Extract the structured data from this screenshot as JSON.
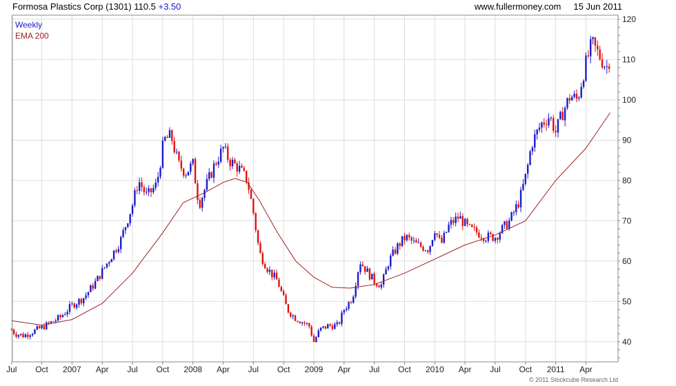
{
  "header": {
    "title": "Formosa Plastics Corp (1301)",
    "last": "110.5",
    "change": "+3.50",
    "site": "www.fullermoney.com",
    "date": "15 Jun 2011"
  },
  "footer": {
    "copyright": "© 2011 Stockcube Research Ltd"
  },
  "colors": {
    "up": "#1a1acc",
    "down": "#e01010",
    "ema": "#a02020",
    "grid": "#dddddd",
    "frame": "#888888"
  },
  "chart_data": {
    "type": "candlestick",
    "interval": "Weekly",
    "ylim": [
      35,
      121
    ],
    "yticks": [
      40,
      50,
      60,
      70,
      80,
      90,
      100,
      110,
      120
    ],
    "xlim": [
      2006.5,
      2011.5
    ],
    "xticks": [
      {
        "label": "Jul",
        "t": 2006.5
      },
      {
        "label": "Oct",
        "t": 2006.75
      },
      {
        "label": "2007",
        "t": 2007.0
      },
      {
        "label": "Apr",
        "t": 2007.25
      },
      {
        "label": "Jul",
        "t": 2007.5
      },
      {
        "label": "Oct",
        "t": 2007.75
      },
      {
        "label": "2008",
        "t": 2008.0
      },
      {
        "label": "Apr",
        "t": 2008.25
      },
      {
        "label": "Jul",
        "t": 2008.5
      },
      {
        "label": "Oct",
        "t": 2008.75
      },
      {
        "label": "2009",
        "t": 2009.0
      },
      {
        "label": "Apr",
        "t": 2009.25
      },
      {
        "label": "Jul",
        "t": 2009.5
      },
      {
        "label": "Oct",
        "t": 2009.75
      },
      {
        "label": "2010",
        "t": 2010.0
      },
      {
        "label": "Apr",
        "t": 2010.25
      },
      {
        "label": "Jul",
        "t": 2010.5
      },
      {
        "label": "Oct",
        "t": 2010.75
      },
      {
        "label": "2011",
        "t": 2011.0
      },
      {
        "label": "Apr",
        "t": 2011.25
      }
    ],
    "price_path": [
      [
        2006.5,
        43
      ],
      [
        2006.53,
        42
      ],
      [
        2006.6,
        41.5
      ],
      [
        2006.75,
        43.5
      ],
      [
        2006.9,
        46
      ],
      [
        2007.0,
        49
      ],
      [
        2007.1,
        51
      ],
      [
        2007.2,
        55
      ],
      [
        2007.3,
        60
      ],
      [
        2007.4,
        65
      ],
      [
        2007.5,
        74
      ],
      [
        2007.55,
        80
      ],
      [
        2007.62,
        76
      ],
      [
        2007.7,
        79
      ],
      [
        2007.76,
        90
      ],
      [
        2007.82,
        91
      ],
      [
        2007.88,
        84
      ],
      [
        2007.94,
        82
      ],
      [
        2008.0,
        84
      ],
      [
        2008.05,
        74
      ],
      [
        2008.1,
        78
      ],
      [
        2008.18,
        84
      ],
      [
        2008.25,
        88
      ],
      [
        2008.3,
        85
      ],
      [
        2008.38,
        83
      ],
      [
        2008.45,
        80
      ],
      [
        2008.5,
        72
      ],
      [
        2008.55,
        62
      ],
      [
        2008.62,
        58
      ],
      [
        2008.7,
        55
      ],
      [
        2008.78,
        48
      ],
      [
        2008.84,
        46
      ],
      [
        2008.9,
        45
      ],
      [
        2008.96,
        44
      ],
      [
        2009.0,
        40
      ],
      [
        2009.05,
        43
      ],
      [
        2009.12,
        44
      ],
      [
        2009.2,
        44
      ],
      [
        2009.25,
        48
      ],
      [
        2009.32,
        51
      ],
      [
        2009.38,
        60
      ],
      [
        2009.45,
        57
      ],
      [
        2009.5,
        55
      ],
      [
        2009.56,
        54
      ],
      [
        2009.62,
        60
      ],
      [
        2009.7,
        64
      ],
      [
        2009.76,
        66
      ],
      [
        2009.85,
        64
      ],
      [
        2009.95,
        63
      ],
      [
        2010.0,
        68
      ],
      [
        2010.05,
        64
      ],
      [
        2010.12,
        69
      ],
      [
        2010.2,
        71
      ],
      [
        2010.28,
        68
      ],
      [
        2010.36,
        67
      ],
      [
        2010.42,
        66
      ],
      [
        2010.5,
        66
      ],
      [
        2010.56,
        68
      ],
      [
        2010.62,
        70
      ],
      [
        2010.7,
        75
      ],
      [
        2010.76,
        82
      ],
      [
        2010.8,
        89
      ],
      [
        2010.88,
        94
      ],
      [
        2010.95,
        96
      ],
      [
        2011.0,
        92
      ],
      [
        2011.06,
        97
      ],
      [
        2011.12,
        101
      ],
      [
        2011.18,
        100
      ],
      [
        2011.24,
        108
      ],
      [
        2011.3,
        114
      ],
      [
        2011.36,
        111
      ],
      [
        2011.42,
        108
      ],
      [
        2011.45,
        110.5
      ]
    ],
    "ema": {
      "name": "EMA 200",
      "points": [
        [
          2006.5,
          45.2
        ],
        [
          2006.75,
          44.1
        ],
        [
          2007.0,
          45.5
        ],
        [
          2007.25,
          49.5
        ],
        [
          2007.5,
          57
        ],
        [
          2007.75,
          67
        ],
        [
          2007.92,
          74.5
        ],
        [
          2008.1,
          77
        ],
        [
          2008.25,
          79.5
        ],
        [
          2008.35,
          80.5
        ],
        [
          2008.45,
          79.5
        ],
        [
          2008.55,
          75
        ],
        [
          2008.7,
          67
        ],
        [
          2008.85,
          60
        ],
        [
          2009.0,
          56
        ],
        [
          2009.15,
          53.5
        ],
        [
          2009.3,
          53.3
        ],
        [
          2009.5,
          54.2
        ],
        [
          2009.75,
          57
        ],
        [
          2010.0,
          60.5
        ],
        [
          2010.25,
          64
        ],
        [
          2010.5,
          66.5
        ],
        [
          2010.75,
          70
        ],
        [
          2011.0,
          80
        ],
        [
          2011.25,
          88
        ],
        [
          2011.45,
          96.8
        ]
      ]
    }
  }
}
